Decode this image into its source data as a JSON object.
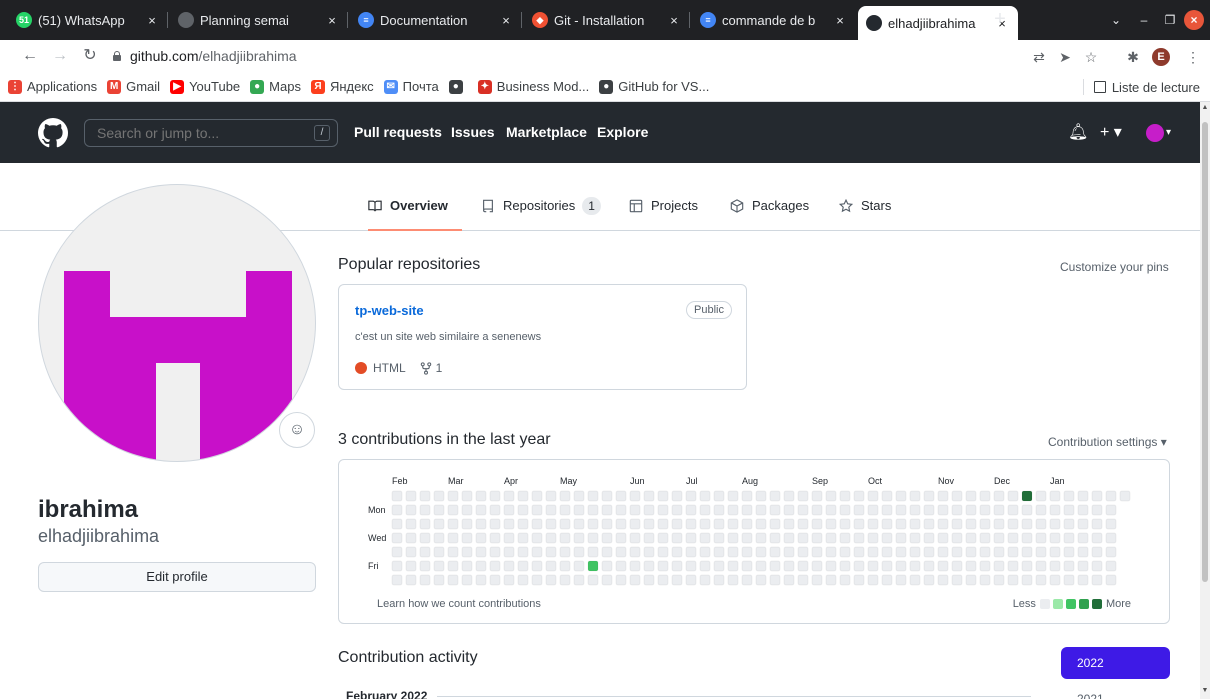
{
  "browser": {
    "tabs": [
      {
        "title": "(51) WhatsApp",
        "favicon_color": "#25d366",
        "favicon_glyph": "51",
        "active": false
      },
      {
        "title": "Planning semai",
        "favicon_color": "#5f6368",
        "favicon_glyph": "",
        "active": false
      },
      {
        "title": "Documentation",
        "favicon_color": "#4285f4",
        "favicon_glyph": "≡",
        "active": false
      },
      {
        "title": "Git - Installation",
        "favicon_color": "#f05133",
        "favicon_glyph": "◆",
        "active": false
      },
      {
        "title": "commande de b",
        "favicon_color": "#4285f4",
        "favicon_glyph": "≡",
        "active": false
      },
      {
        "title": "elhadjiibrahima",
        "favicon_color": "#24292f",
        "favicon_glyph": "",
        "active": true
      }
    ],
    "new_tab_label": "+",
    "url_host": "github.com",
    "url_path": "/elhadjiibrahima",
    "profile_initial": "E",
    "bookmarks": [
      {
        "label": "Applications",
        "icon_color": "#ea4335",
        "glyph": "⋮"
      },
      {
        "label": "Gmail",
        "icon_color": "#ea4335",
        "glyph": "M"
      },
      {
        "label": "YouTube",
        "icon_color": "#ff0000",
        "glyph": "▶"
      },
      {
        "label": "Maps",
        "icon_color": "#34a853",
        "glyph": "●"
      },
      {
        "label": "Яндекс",
        "icon_color": "#fc3f1d",
        "glyph": "Я"
      },
      {
        "label": "Почта",
        "icon_color": "#4f8ef7",
        "glyph": "✉"
      },
      {
        "label": "",
        "icon_color": "#3c4043",
        "glyph": "●"
      },
      {
        "label": "Business Mod...",
        "icon_color": "#d93025",
        "glyph": "✦"
      },
      {
        "label": "GitHub for VS...",
        "icon_color": "#3c4043",
        "glyph": "●"
      }
    ],
    "reading_list_label": "Liste de lecture"
  },
  "github": {
    "search_placeholder": "Search or jump to...",
    "search_key": "/",
    "nav": [
      "Pull requests",
      "Issues",
      "Marketplace",
      "Explore"
    ],
    "accent_color": "#fd8c73"
  },
  "profile_tabs": [
    {
      "label": "Overview",
      "icon": "book-icon",
      "active": true
    },
    {
      "label": "Repositories",
      "icon": "repo-icon",
      "count": "1",
      "active": false
    },
    {
      "label": "Projects",
      "icon": "project-icon",
      "active": false
    },
    {
      "label": "Packages",
      "icon": "package-icon",
      "active": false
    },
    {
      "label": "Stars",
      "icon": "star-icon",
      "active": false
    }
  ],
  "profile": {
    "display_name": "ibrahima",
    "username": "elhadjiibrahima",
    "edit_button": "Edit profile",
    "avatar_color": "#c810c9"
  },
  "popular": {
    "title": "Popular repositories",
    "customize_label": "Customize your pins",
    "repo": {
      "name": "tp-web-site",
      "visibility": "Public",
      "description": "c'est un site web similaire a senenews",
      "language": "HTML",
      "language_color": "#e34c26",
      "forks": "1"
    }
  },
  "contributions": {
    "title": "3 contributions in the last year",
    "settings_label": "Contribution settings ▾",
    "months": [
      "Feb",
      "Mar",
      "Apr",
      "May",
      "Jun",
      "Jul",
      "Aug",
      "Sep",
      "Oct",
      "Nov",
      "Dec",
      "Jan"
    ],
    "weekday_labels": [
      "Mon",
      "Wed",
      "Fri"
    ],
    "learn_link": "Learn how we count contributions",
    "legend_less": "Less",
    "legend_more": "More",
    "legend_colors": [
      "#ebedf0",
      "#9be9a8",
      "#40c463",
      "#30a14e",
      "#216e39"
    ],
    "active_cells": [
      {
        "week": 14,
        "day": 5,
        "level": 2
      },
      {
        "week": 45,
        "day": 0,
        "level": 4
      }
    ],
    "weeks": 53
  },
  "activity": {
    "title": "Contribution activity",
    "month": "February 2022",
    "years": [
      "2022",
      "2021"
    ]
  }
}
